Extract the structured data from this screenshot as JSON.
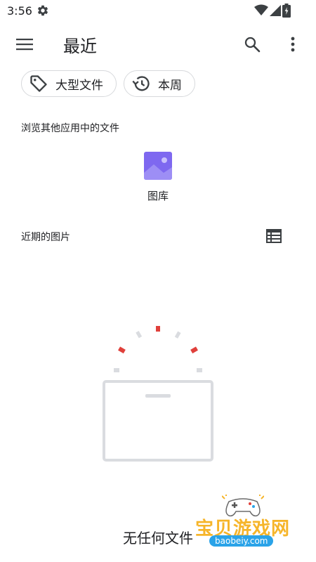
{
  "status_bar": {
    "time": "3:56",
    "icons": [
      "settings-icon",
      "wifi-icon",
      "signal-icon",
      "battery-icon"
    ]
  },
  "app_bar": {
    "title": "最近",
    "icons": [
      "menu-icon",
      "search-icon",
      "more-vert-icon"
    ]
  },
  "chips": [
    {
      "label": "大型文件",
      "icon": "tag-icon"
    },
    {
      "label": "本周",
      "icon": "history-icon"
    }
  ],
  "browse": {
    "heading": "浏览其他应用中的文件",
    "apps": [
      {
        "label": "图库",
        "icon": "gallery-icon"
      }
    ]
  },
  "recent": {
    "heading": "近期的图片",
    "view_toggle_icon": "list-view-icon"
  },
  "empty_state": {
    "text": "无任何文件",
    "illustration": "empty-tray-icon"
  },
  "watermark": {
    "text": "宝贝游戏网",
    "url": "baobeiy.com"
  },
  "colors": {
    "accent": "#7e68f0",
    "spinner_red": "#e0403b",
    "spinner_gray": "#dadce0",
    "chip_border": "#d7d9dc",
    "watermark_orange": "#f6b52a",
    "watermark_blue": "#2aa3e8"
  }
}
